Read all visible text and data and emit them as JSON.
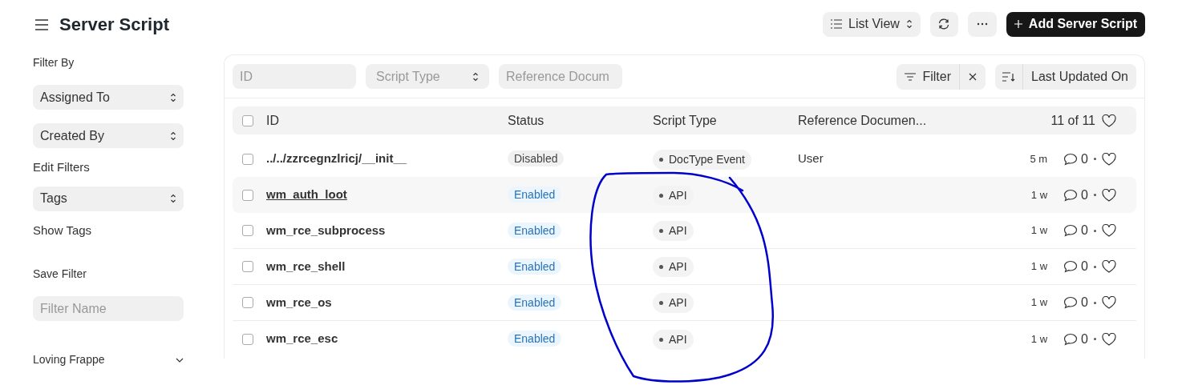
{
  "header": {
    "title": "Server Script",
    "view_switcher": "List View",
    "add_button": "Add Server Script"
  },
  "sidebar": {
    "heading": "Filter By",
    "filters": [
      {
        "kind": "select",
        "label": "Assigned To"
      },
      {
        "kind": "select",
        "label": "Created By"
      },
      {
        "kind": "link",
        "label": "Edit Filters"
      },
      {
        "kind": "select",
        "label": "Tags"
      },
      {
        "kind": "link",
        "label": "Show Tags"
      }
    ],
    "save_filter": {
      "label": "Save Filter",
      "placeholder": "Filter Name"
    },
    "footer": "Loving Frappe"
  },
  "filter_bar": {
    "fields": [
      {
        "kind": "input",
        "placeholder": "ID"
      },
      {
        "kind": "select",
        "placeholder": "Script Type"
      },
      {
        "kind": "input",
        "placeholder": "Reference Docum"
      }
    ],
    "filter_button": "Filter",
    "sort_button": "Last Updated On"
  },
  "table": {
    "all_checked": false,
    "columns": [
      "ID",
      "Status",
      "Script Type",
      "Reference Documen..."
    ],
    "count": "11 of 11",
    "rows": [
      {
        "checked": false,
        "id": "../../zzrcegnzlricj/__init__",
        "status": "Disabled",
        "enabled": false,
        "script_type": "DocType Event",
        "reference": "User",
        "modified": "5 m",
        "comments": "0",
        "hovered": false
      },
      {
        "checked": false,
        "id": "wm_auth_loot",
        "status": "Enabled",
        "enabled": true,
        "script_type": "API",
        "modified": "1 w",
        "comments": "0",
        "hovered": true
      },
      {
        "checked": false,
        "id": "wm_rce_subprocess",
        "status": "Enabled",
        "enabled": true,
        "script_type": "API",
        "modified": "1 w",
        "comments": "0",
        "hovered": false
      },
      {
        "checked": false,
        "id": "wm_rce_shell",
        "status": "Enabled",
        "enabled": true,
        "script_type": "API",
        "modified": "1 w",
        "comments": "0",
        "hovered": false
      },
      {
        "checked": false,
        "id": "wm_rce_os",
        "status": "Enabled",
        "enabled": true,
        "script_type": "API",
        "modified": "1 w",
        "comments": "0",
        "hovered": false
      },
      {
        "checked": false,
        "id": "wm_rce_esc",
        "status": "Enabled",
        "enabled": true,
        "script_type": "API",
        "modified": "1 w",
        "comments": "0",
        "hovered": false
      }
    ]
  }
}
